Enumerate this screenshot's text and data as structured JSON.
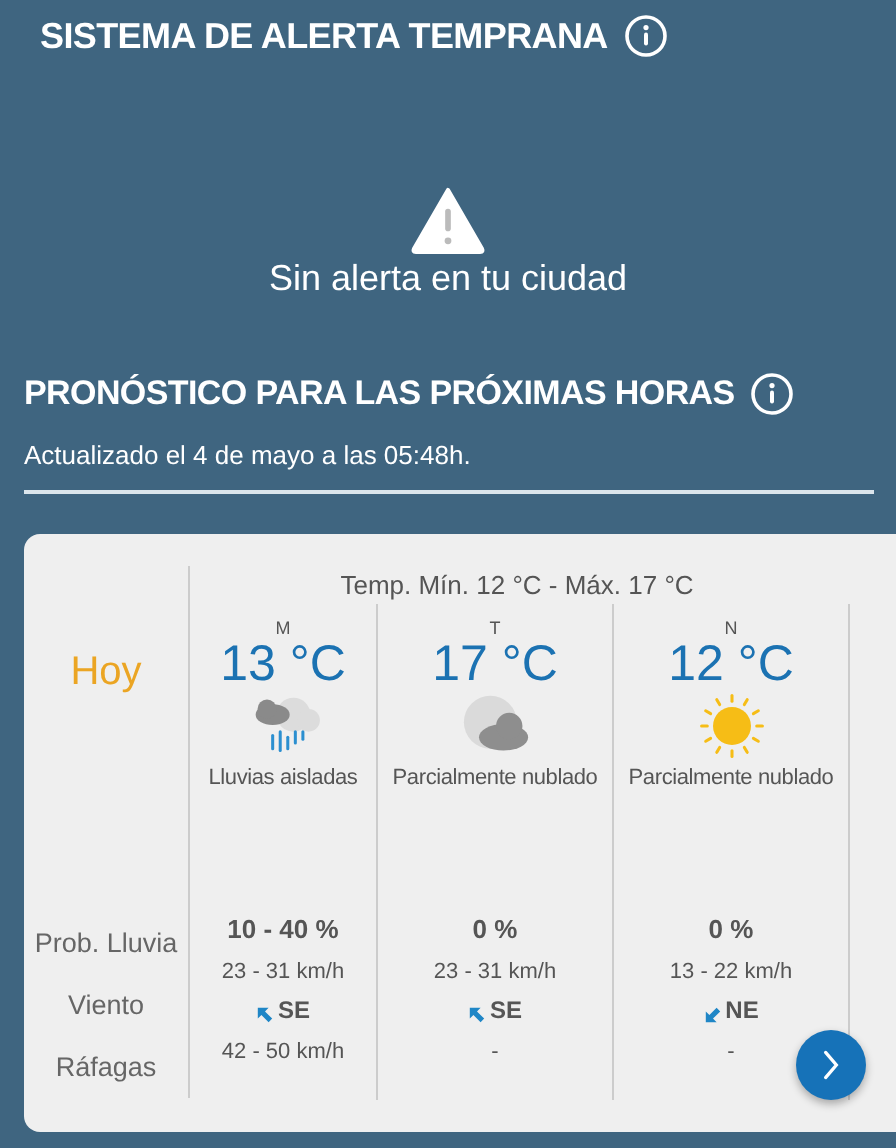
{
  "alert_section": {
    "title": "SISTEMA DE ALERTA TEMPRANA",
    "message": "Sin alerta en tu ciudad"
  },
  "forecast_section": {
    "title": "PRONÓSTICO PARA LAS PRÓXIMAS HORAS",
    "updated": "Actualizado el 4 de mayo a las 05:48h."
  },
  "forecast_card": {
    "day_label": "Hoy",
    "temp_range": "Temp. Mín. 12 °C - Máx. 17 °C",
    "row_labels": [
      "Prob. Lluvia",
      "Viento",
      "Ráfagas"
    ],
    "periods": [
      {
        "period": "M",
        "temperature": "13 °C",
        "weather_icon": {
          "kind": "rain"
        },
        "description": "Lluvias aisladas",
        "rain_probability": "10 - 40 %",
        "wind_speed": "23 - 31 km/h",
        "wind_arrow": {
          "kind": "up-left"
        },
        "wind_direction": "SE",
        "gusts": "42 - 50 km/h"
      },
      {
        "period": "T",
        "temperature": "17 °C",
        "weather_icon": {
          "kind": "cloudy-night"
        },
        "description": "Parcialmente nublado",
        "rain_probability": "0 %",
        "wind_speed": "23 - 31 km/h",
        "wind_arrow": {
          "kind": "up-left"
        },
        "wind_direction": "SE",
        "gusts": "-"
      },
      {
        "period": "N",
        "temperature": "12 °C",
        "weather_icon": {
          "kind": "sun"
        },
        "description": "Parcialmente nublado",
        "rain_probability": "0 %",
        "wind_speed": "13 - 22 km/h",
        "wind_arrow": {
          "kind": "down-left"
        },
        "wind_direction": "NE",
        "gusts": "-"
      }
    ]
  }
}
